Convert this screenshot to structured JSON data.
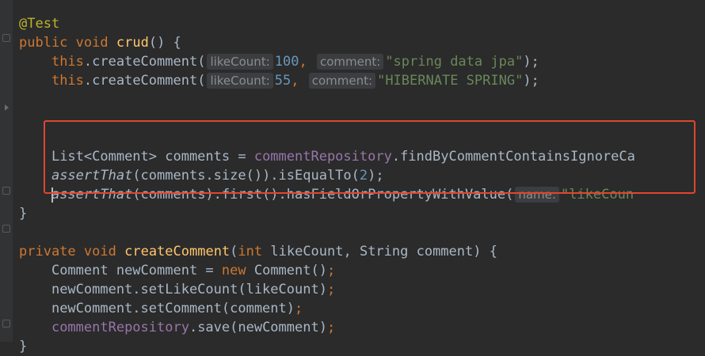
{
  "code": {
    "annotation": "@Test",
    "l1": {
      "public": "public",
      "void": "void",
      "name": "crud",
      "rest": "() {"
    },
    "l2": {
      "this": "this",
      "call": ".createComment(",
      "hint1": "likeCount:",
      "num": "100",
      "sep": ",",
      "hint2": "comment:",
      "str": "\"spring data jpa\"",
      "end": ");"
    },
    "l3": {
      "this": "this",
      "call": ".createComment(",
      "hint1": "likeCount:",
      "num": "55",
      "sep": ",",
      "hint2": "comment:",
      "str": "\"HIBERNATE SPRING\"",
      "end": ");"
    },
    "l6": {
      "type": "List<Comment> comments = ",
      "repo": "commentRepository",
      "call": ".findByCommentContainsIgnoreCa"
    },
    "l7": {
      "assert": "assertThat",
      "mid": "(comments.size()).isEqualTo(",
      "num": "2",
      "end": ");"
    },
    "l8": {
      "assert": "assertThat",
      "mid": "(comments).first().hasFieldOrPropertyWithValue(",
      "hint": "name:",
      "str": "\"likeCoun"
    },
    "l9": "}",
    "l11": {
      "private": "private",
      "void": "void",
      "name": "createComment",
      "open": "(",
      "int": "int",
      "args": " likeCount, String comment) {"
    },
    "l12": {
      "decl": "Comment newComment = ",
      "new": "new",
      "rest": " Comment()",
      "semi": ";"
    },
    "l13": {
      "text": "newComment.setLikeCount(likeCount)",
      "semi": ";"
    },
    "l14": {
      "text": "newComment.setComment(comment)",
      "semi": ";"
    },
    "l15": {
      "repo": "commentRepository",
      "rest": ".save(newComment)",
      "semi": ";"
    },
    "l16": "}"
  },
  "colors": {
    "keyword": "#cc7832",
    "annotation": "#bbb529",
    "method": "#ffc66d",
    "number": "#6897bb",
    "string": "#6a8759",
    "field": "#9876aa",
    "highlight": "#e0462f"
  }
}
